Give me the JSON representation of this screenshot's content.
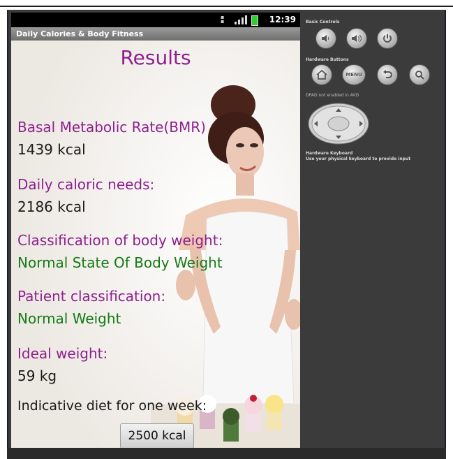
{
  "app": {
    "title": "Daily Calories & Body Fitness",
    "status_time": "12:39"
  },
  "results": {
    "heading": "Results",
    "bmr_label": "Basal Metabolic Rate(BMR)",
    "bmr_value": "1439 kcal",
    "daily_label": "Daily caloric needs:",
    "daily_value": "2186 kcal",
    "classification_label": "Classification of body weight:",
    "classification_value": "Normal State Of Body Weight",
    "patient_label": "Patient classification:",
    "patient_value": "Normal Weight",
    "ideal_label": "Ideal weight:",
    "ideal_value": "59 kg",
    "diet_label": "Indicative diet for one week:",
    "diet_button": "2500 kcal"
  },
  "colors": {
    "label": "#8e1f8e",
    "value": "#1a1a1a",
    "classification": "#157a15",
    "panel_bg": "#3b3b3b"
  },
  "emulator": {
    "basic_controls": "Basic Controls",
    "hardware_buttons": "Hardware Buttons",
    "menu_label": "MENU",
    "dpad_note": "DPAD not enabled in AVD",
    "keyboard_title": "Hardware Keyboard",
    "keyboard_note": "Use your physical keyboard to provide input",
    "icons": [
      "volume-down-icon",
      "volume-up-icon",
      "power-icon",
      "home-icon",
      "menu-icon",
      "back-icon",
      "search-icon",
      "dpad"
    ]
  }
}
